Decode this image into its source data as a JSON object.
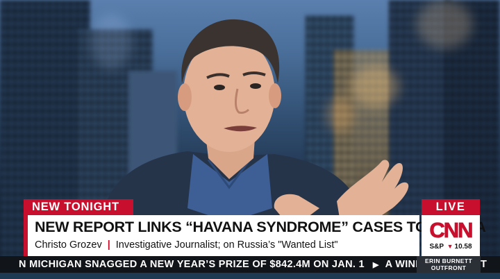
{
  "banner": {
    "tag": "NEW TONIGHT",
    "live_label": "LIVE",
    "headline": "NEW REPORT LINKS “HAVANA SYNDROME” CASES TO RUSSIA",
    "speaker_name": "Christo Grozev",
    "separator": "|",
    "speaker_title": "Investigative Journalist; on Russia’s \"Wanted List\""
  },
  "network": {
    "logo_text": "CNN",
    "stock_label": "S&P",
    "stock_change": "10.58",
    "stock_direction": "down"
  },
  "crawl": {
    "items": [
      "N MICHIGAN SNAGGED A NEW YEAR’S PRIZE OF $842.4M ON JAN. 1",
      "A WINNER TONIGHT"
    ],
    "arrow": "▶"
  },
  "show": {
    "line1": "ERIN BURNETT",
    "line2": "OUTFRONT"
  },
  "colors": {
    "brand_red": "#c8102e",
    "banner_white": "#ffffff",
    "crawl_bg": "#111418"
  }
}
